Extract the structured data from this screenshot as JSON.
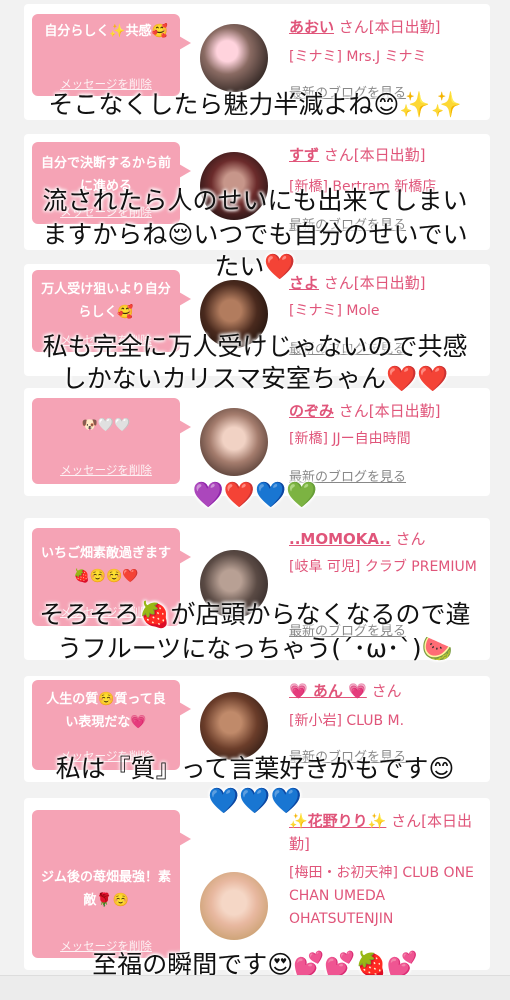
{
  "cards": [
    {
      "message": "自分らしく✨共感🥰",
      "delete_label": "メッセージを削除",
      "name": "あおい",
      "name_suffix": " さん[本日出勤]",
      "info": "[ミナミ] Mrs.J ミナミ",
      "blog_link": "最新のブログを見る"
    },
    {
      "message": "自分で決断するから前に進める",
      "delete_label": "メッセージを削除",
      "name": "すず",
      "name_suffix": " さん[本日出勤]",
      "info": "[新橋] Bertram 新橋店",
      "blog_link": "最新のブログを見る"
    },
    {
      "message": "万人受け狙いより自分らしく🥰",
      "delete_label": "メッセージを削除",
      "name": "さよ",
      "name_suffix": " さん[本日出勤]",
      "info": "[ミナミ] Mole",
      "blog_link": "最新のブログを見る"
    },
    {
      "message": "🐶🤍🤍",
      "delete_label": "メッセージを削除",
      "name": "のぞみ",
      "name_suffix": " さん[本日出勤]",
      "info": "[新橋] JJー自由時間",
      "blog_link": "最新のブログを見る"
    },
    {
      "message": "いちご畑素敵過ぎます🍓☺️☺️❤️",
      "delete_label": "メッセージを削除",
      "name": "..MOMOKA..",
      "name_suffix": " さん",
      "info": "[岐阜 可児] クラブ PREMIUM",
      "blog_link": "最新のブログを見る"
    },
    {
      "message": "人生の質☺️質って良い表現だな💗",
      "delete_label": "メッセージを削除",
      "name": "💗 あん 💗",
      "name_suffix": " さん",
      "info": "[新小岩] CLUB M.",
      "blog_link": "最新のブログを見る"
    },
    {
      "message": "ジム後の苺畑最強！素敵🌹☺️",
      "delete_label": "メッセージを削除",
      "name": "✨花野りり✨",
      "name_suffix": " さん[本日出勤]",
      "info": "[梅田・お初天神] CLUB ONE CHAN UMEDA OHATSUTENJIN",
      "blog_link": "最新のブログを見る"
    }
  ],
  "overlay": {
    "line1": "そこなくしたら魅力半減よね😊✨✨",
    "line2a": "流されたら人のせいにも出来てしまい",
    "line2b": "ますからね😌いつでも自分のせいでい",
    "line2c": "たい❤️",
    "line3a": "私も完全に万人受けじゃないので共感",
    "line3b": "しかないカリスマ安室ちゃん❤️❤️",
    "line4": "💜❤️💙💚",
    "line5a": "そろそろ🍓が店頭からなくなるので違",
    "line5b": "うフルーツになっちゃう(´･ω･`)🍉",
    "line6a": "私は『質』って言葉好きかもです😊",
    "line6b": "💙💙💙",
    "line7": "至福の瞬間です😍💕💕🍓💕"
  }
}
